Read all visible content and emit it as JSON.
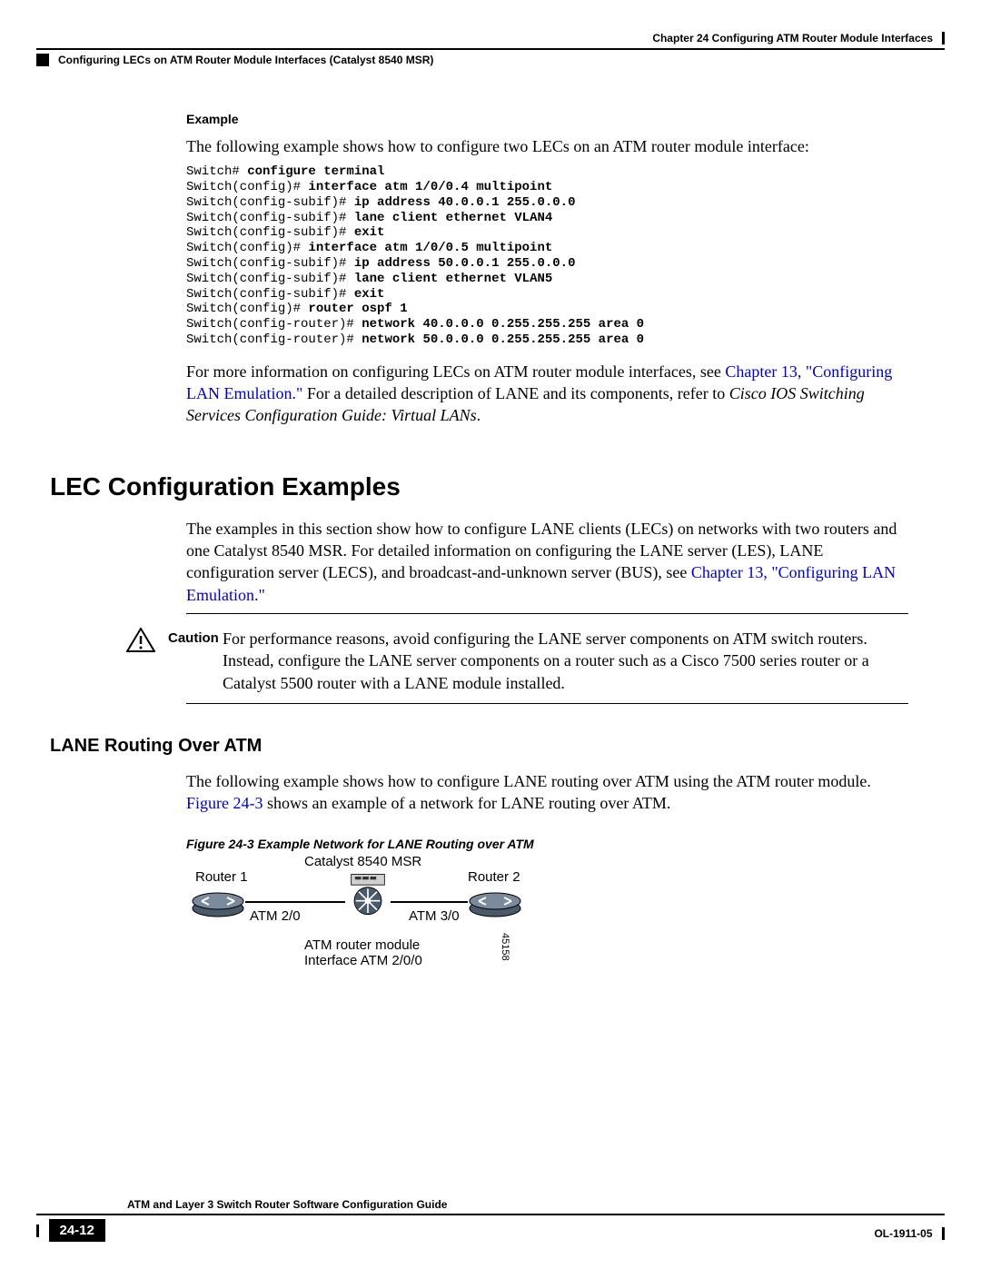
{
  "header": {
    "chapter": "Chapter 24    Configuring ATM Router Module Interfaces",
    "section": "Configuring LECs on ATM Router Module Interfaces (Catalyst 8540 MSR)"
  },
  "example": {
    "label": "Example",
    "intro": "The following example shows how to configure two LECs on an ATM router module interface:",
    "code": [
      {
        "p": "Switch# ",
        "b": "configure terminal"
      },
      {
        "p": "Switch(config)# ",
        "b": "interface atm 1/0/0.4 multipoint"
      },
      {
        "p": "Switch(config-subif)# ",
        "b": "ip address 40.0.0.1 255.0.0.0"
      },
      {
        "p": "Switch(config-subif)# ",
        "b": "lane client ethernet VLAN4"
      },
      {
        "p": "Switch(config-subif)# ",
        "b": "exit"
      },
      {
        "p": "Switch(config)# ",
        "b": "interface atm 1/0/0.5 multipoint"
      },
      {
        "p": "Switch(config-subif)# ",
        "b": "ip address 50.0.0.1 255.0.0.0"
      },
      {
        "p": "Switch(config-subif)# ",
        "b": "lane client ethernet VLAN5"
      },
      {
        "p": "Switch(config-subif)# ",
        "b": "exit"
      },
      {
        "p": "Switch(config)# ",
        "b": "router ospf 1"
      },
      {
        "p": "Switch(config-router)# ",
        "b": "network 40.0.0.0 0.255.255.255 area 0"
      },
      {
        "p": "Switch(config-router)# ",
        "b": "network 50.0.0.0 0.255.255.255 area 0"
      }
    ],
    "post_t1": "For more information on configuring LECs on ATM router module interfaces, see ",
    "post_link": "Chapter 13, \"Configuring LAN Emulation.\"",
    "post_t2": " For a detailed description of LANE and its components, refer to ",
    "post_italic": "Cisco IOS Switching Services Configuration Guide: Virtual LANs",
    "post_t3": "."
  },
  "lec": {
    "heading": "LEC Configuration Examples",
    "para_t1": "The examples in this section show how to configure LANE clients (LECs) on networks with two routers and one Catalyst 8540 MSR. For detailed information on configuring the LANE server (LES), LANE configuration server (LECS), and broadcast-and-unknown server (BUS), see ",
    "para_link": "Chapter 13, \"Configuring LAN Emulation.\""
  },
  "caution": {
    "label": "Caution",
    "text": "For performance reasons, avoid configuring the LANE server components on ATM switch routers. Instead, configure the LANE server components on a router such as a Cisco 7500 series router or a Catalyst 5500 router with a LANE module installed."
  },
  "lane": {
    "heading": "LANE Routing Over ATM",
    "para_t1": "The following example shows how to configure LANE routing over ATM using the ATM router module. ",
    "para_link": "Figure 24-3",
    "para_t2": " shows an example of a network for LANE routing over ATM.",
    "fig_caption": "Figure 24-3   Example Network for LANE Routing over ATM"
  },
  "diagram": {
    "router1": "Router 1",
    "router2": "Router 2",
    "switch": "Catalyst 8540 MSR",
    "atm20": "ATM 2/0",
    "atm30": "ATM 3/0",
    "module": "ATM router module",
    "iface": "Interface ATM 2/0/0",
    "id": "45158"
  },
  "footer": {
    "title": "ATM and Layer 3 Switch Router Software Configuration Guide",
    "pagenum": "24-12",
    "docid": "OL-1911-05"
  }
}
